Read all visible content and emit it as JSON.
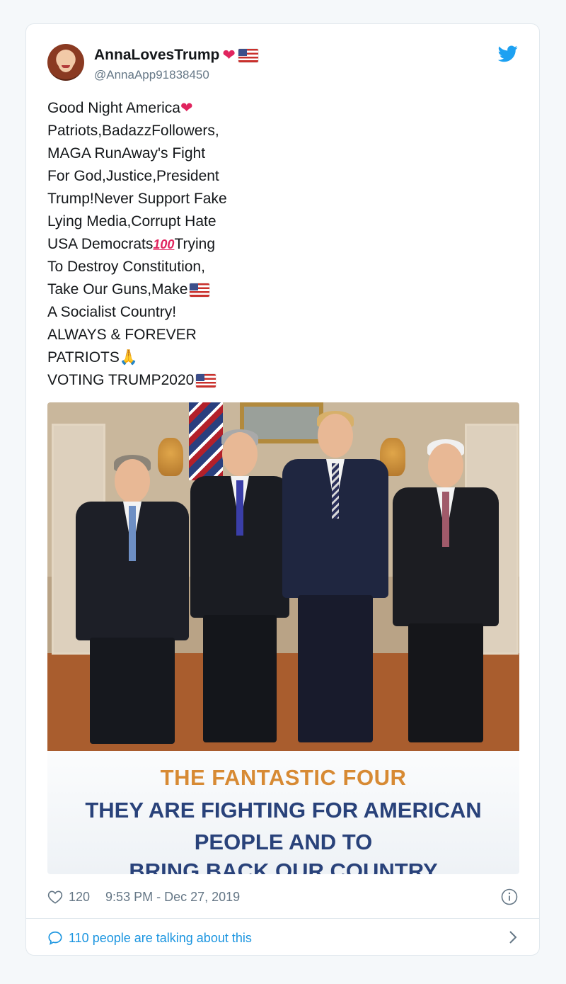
{
  "tweet": {
    "author": {
      "display_name": "AnnaLovesTrump",
      "handle": "@AnnaApp91838450"
    },
    "text_lines": [
      "Good Night America",
      "Patriots,BadazzFollowers,",
      "MAGA RunAway's Fight",
      "For God,Justice,President",
      "Trump!Never Support Fake",
      "Lying Media,Corrupt Hate",
      "USA Democrats",
      "Trying",
      "To Destroy Constitution,",
      "Take Our Guns,Make",
      "A Socialist Country!",
      "ALWAYS & FOREVER",
      "PATRIOTS",
      "VOTING TRUMP2020"
    ],
    "emoji": {
      "heart": "❤",
      "hundred": "100",
      "pray": "🙏"
    },
    "image_caption": {
      "title": "THE FANTASTIC FOUR",
      "line1": "THEY ARE FIGHTING FOR AMERICAN",
      "line2": "PEOPLE AND TO",
      "line3": "BRING BACK OUR COUNTRY"
    },
    "like_count": "120",
    "timestamp": "9:53 PM - Dec 27, 2019",
    "talking": "110 people are talking about this"
  },
  "colors": {
    "accent": "#1b95e0",
    "twitter_blue": "#1da1f2",
    "heart_red": "#e0245e",
    "caption_orange": "#d78a34",
    "caption_navy": "#29427a"
  },
  "icons": [
    "twitter-bird-icon",
    "heart-icon",
    "info-icon",
    "speech-bubble-icon",
    "chevron-right-icon",
    "us-flag-icon"
  ]
}
